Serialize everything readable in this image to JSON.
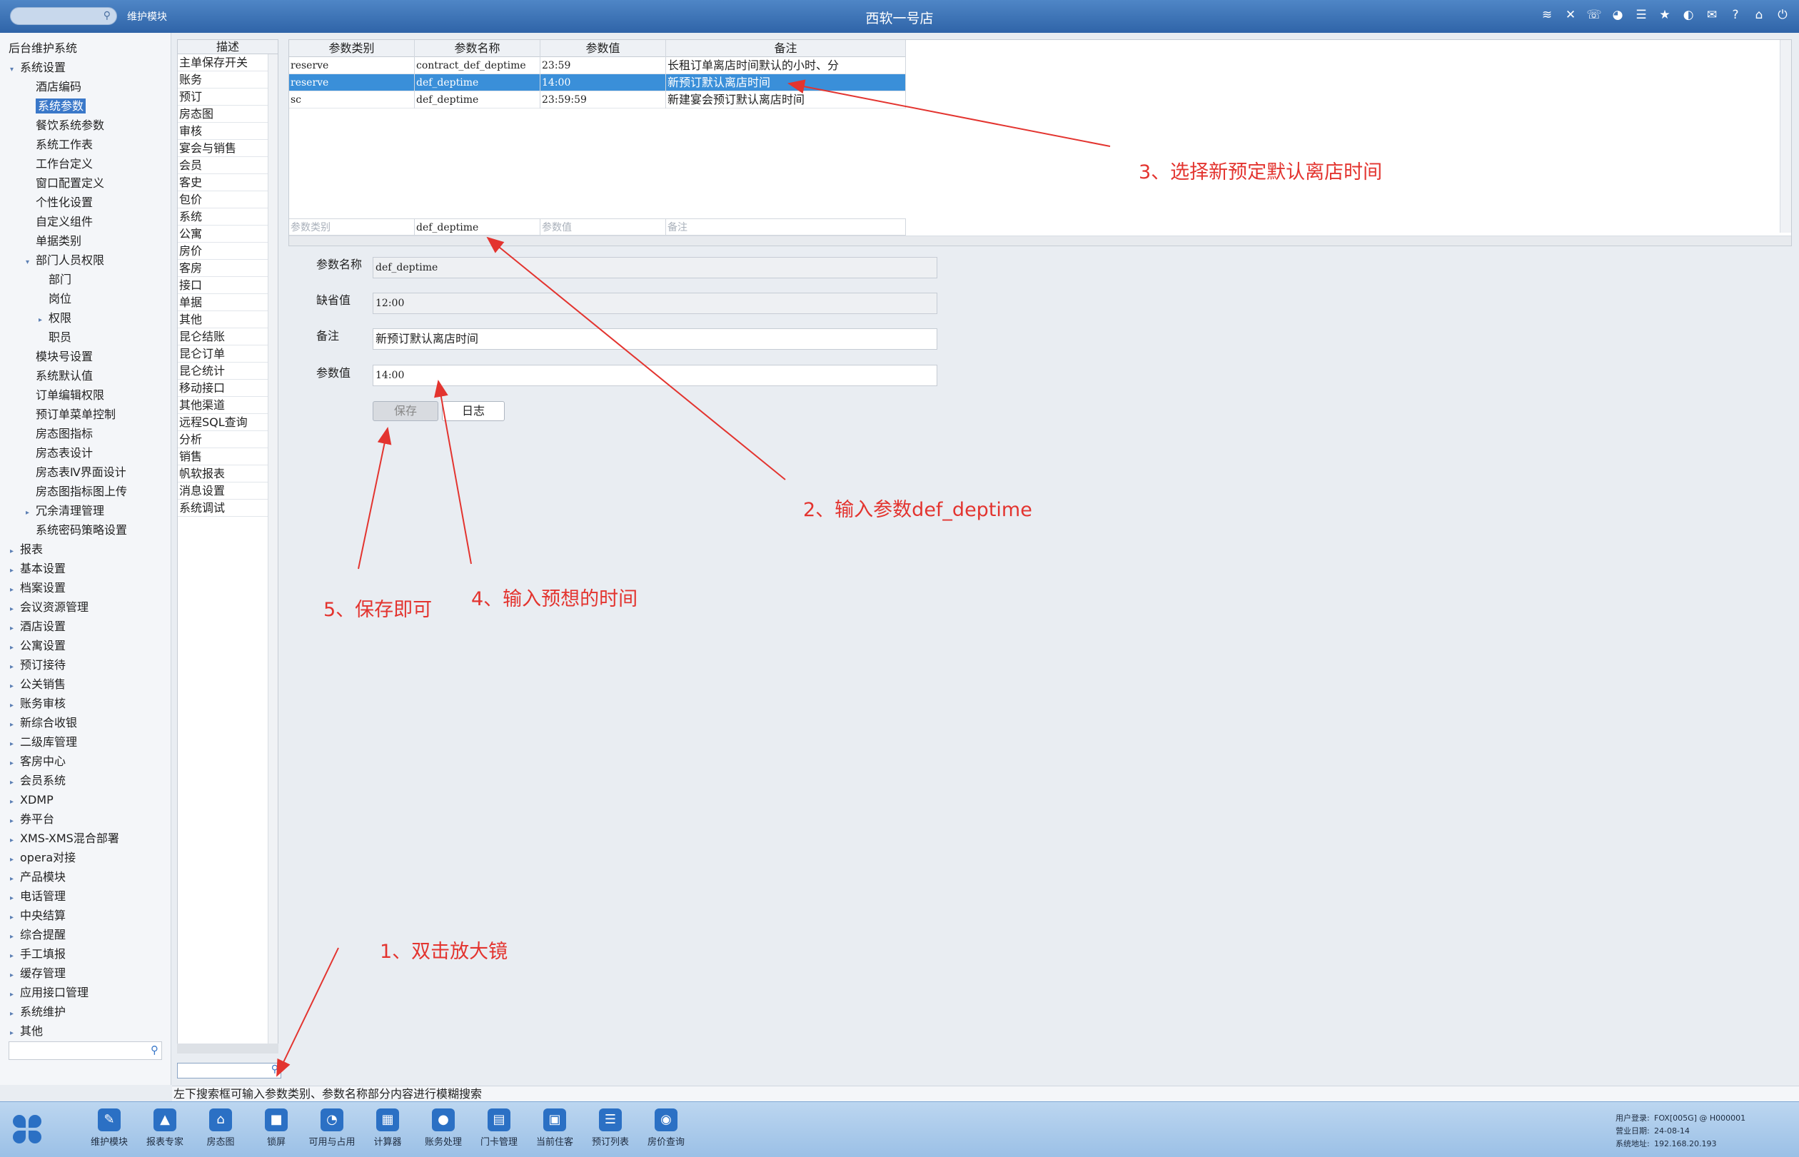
{
  "titlebar": {
    "module": "维护模块",
    "store": "西软一号店",
    "icons": [
      "wifi-icon",
      "tools-icon",
      "phone-icon",
      "palette-icon",
      "menu-icon",
      "star-icon",
      "contrast-icon",
      "mail-icon",
      "help-icon",
      "home-icon",
      "power-icon"
    ]
  },
  "nav": {
    "root": "后台维护系统",
    "items": [
      {
        "label": "系统设置",
        "level": 1,
        "arrow": "▾"
      },
      {
        "label": "酒店编码",
        "level": 2,
        "arrow": ""
      },
      {
        "label": "系统参数",
        "level": 2,
        "arrow": "",
        "selected": true
      },
      {
        "label": "餐饮系统参数",
        "level": 2,
        "arrow": ""
      },
      {
        "label": "系统工作表",
        "level": 2,
        "arrow": ""
      },
      {
        "label": "工作台定义",
        "level": 2,
        "arrow": ""
      },
      {
        "label": "窗口配置定义",
        "level": 2,
        "arrow": ""
      },
      {
        "label": "个性化设置",
        "level": 2,
        "arrow": ""
      },
      {
        "label": "自定义组件",
        "level": 2,
        "arrow": ""
      },
      {
        "label": "单据类别",
        "level": 2,
        "arrow": ""
      },
      {
        "label": "部门人员权限",
        "level": 2,
        "arrow": "▾"
      },
      {
        "label": "部门",
        "level": 3,
        "arrow": ""
      },
      {
        "label": "岗位",
        "level": 3,
        "arrow": ""
      },
      {
        "label": "权限",
        "level": 3,
        "arrow": "▸"
      },
      {
        "label": "职员",
        "level": 3,
        "arrow": ""
      },
      {
        "label": "模块号设置",
        "level": 2,
        "arrow": ""
      },
      {
        "label": "系统默认值",
        "level": 2,
        "arrow": ""
      },
      {
        "label": "订单编辑权限",
        "level": 2,
        "arrow": ""
      },
      {
        "label": "预订单菜单控制",
        "level": 2,
        "arrow": ""
      },
      {
        "label": "房态图指标",
        "level": 2,
        "arrow": ""
      },
      {
        "label": "房态表设计",
        "level": 2,
        "arrow": ""
      },
      {
        "label": "房态表Ⅳ界面设计",
        "level": 2,
        "arrow": ""
      },
      {
        "label": "房态图指标图上传",
        "level": 2,
        "arrow": ""
      },
      {
        "label": "冗余清理管理",
        "level": 2,
        "arrow": "▸"
      },
      {
        "label": "系统密码策略设置",
        "level": 2,
        "arrow": ""
      },
      {
        "label": "报表",
        "level": 1,
        "arrow": "▸"
      },
      {
        "label": "基本设置",
        "level": 1,
        "arrow": "▸"
      },
      {
        "label": "档案设置",
        "level": 1,
        "arrow": "▸"
      },
      {
        "label": "会议资源管理",
        "level": 1,
        "arrow": "▸"
      },
      {
        "label": "酒店设置",
        "level": 1,
        "arrow": "▸"
      },
      {
        "label": "公寓设置",
        "level": 1,
        "arrow": "▸"
      },
      {
        "label": "预订接待",
        "level": 1,
        "arrow": "▸"
      },
      {
        "label": "公关销售",
        "level": 1,
        "arrow": "▸"
      },
      {
        "label": "账务审核",
        "level": 1,
        "arrow": "▸"
      },
      {
        "label": "新综合收银",
        "level": 1,
        "arrow": "▸"
      },
      {
        "label": "二级库管理",
        "level": 1,
        "arrow": "▸"
      },
      {
        "label": "客房中心",
        "level": 1,
        "arrow": "▸"
      },
      {
        "label": "会员系统",
        "level": 1,
        "arrow": "▸"
      },
      {
        "label": "XDMP",
        "level": 1,
        "arrow": "▸"
      },
      {
        "label": "券平台",
        "level": 1,
        "arrow": "▸"
      },
      {
        "label": "XMS-XMS混合部署",
        "level": 1,
        "arrow": "▸"
      },
      {
        "label": "opera对接",
        "level": 1,
        "arrow": "▸"
      },
      {
        "label": "产品模块",
        "level": 1,
        "arrow": "▸"
      },
      {
        "label": "电话管理",
        "level": 1,
        "arrow": "▸"
      },
      {
        "label": "中央结算",
        "level": 1,
        "arrow": "▸"
      },
      {
        "label": "综合提醒",
        "level": 1,
        "arrow": "▸"
      },
      {
        "label": "手工填报",
        "level": 1,
        "arrow": "▸"
      },
      {
        "label": "缓存管理",
        "level": 1,
        "arrow": "▸"
      },
      {
        "label": "应用接口管理",
        "level": 1,
        "arrow": "▸"
      },
      {
        "label": "系统维护",
        "level": 1,
        "arrow": "▸"
      },
      {
        "label": "其他",
        "level": 1,
        "arrow": "▸"
      }
    ]
  },
  "desc": {
    "header": "描述",
    "rows": [
      "主单保存开关",
      "账务",
      "预订",
      "房态图",
      "审核",
      "宴会与销售",
      "会员",
      "客史",
      "包价",
      "系统",
      "公寓",
      "房价",
      "客房",
      "接口",
      "单据",
      "其他",
      "昆仑结账",
      "昆仑订单",
      "昆仑统计",
      "移动接口",
      "其他渠道",
      "远程SQL查询",
      "分析",
      "销售",
      "帆软报表",
      "消息设置",
      "系统调试"
    ]
  },
  "table": {
    "columns": [
      "参数类别",
      "参数名称",
      "参数值",
      "备注"
    ],
    "rows": [
      [
        "reserve",
        "contract_def_deptime",
        "23:59",
        "长租订单离店时间默认的小时、分"
      ],
      [
        "reserve",
        "def_deptime",
        "14:00",
        "新预订默认离店时间"
      ],
      [
        "sc",
        "def_deptime",
        "23:59:59",
        "新建宴会预订默认离店时间"
      ]
    ],
    "selected_row": 1,
    "filter": [
      "参数类别",
      "def_deptime",
      "参数值",
      "备注"
    ]
  },
  "form": {
    "name_label": "参数名称",
    "name_value": "def_deptime",
    "default_label": "缺省值",
    "default_value": "12:00",
    "remark_label": "备注",
    "remark_value": "新预订默认离店时间",
    "value_label": "参数值",
    "value_value": "14:00",
    "save": "保存",
    "log": "日志"
  },
  "annotations": {
    "a1": "1、双击放大镜",
    "a2": "2、输入参数def_deptime",
    "a3": "3、选择新预定默认离店时间",
    "a4": "4、输入预想的时间",
    "a5": "5、保存即可",
    "color": "#e3342f"
  },
  "status": "左下搜索框可输入参数类别、参数名称部分内容进行模糊搜索",
  "taskbar": {
    "items": [
      {
        "label": "维护模块",
        "icon": "wrench-icon",
        "glyph": "✎"
      },
      {
        "label": "报表专家",
        "icon": "graduation-icon",
        "glyph": "▲"
      },
      {
        "label": "房态图",
        "icon": "building-icon",
        "glyph": "⌂"
      },
      {
        "label": "锁屏",
        "icon": "lock-icon",
        "glyph": "■"
      },
      {
        "label": "可用与占用",
        "icon": "pie-chart-icon",
        "glyph": "◔"
      },
      {
        "label": "计算器",
        "icon": "calculator-icon",
        "glyph": "▦"
      },
      {
        "label": "账务处理",
        "icon": "accounting-icon",
        "glyph": "●"
      },
      {
        "label": "门卡管理",
        "icon": "door-card-icon",
        "glyph": "▤"
      },
      {
        "label": "当前住客",
        "icon": "guest-card-icon",
        "glyph": "▣"
      },
      {
        "label": "预订列表",
        "icon": "booking-list-icon",
        "glyph": "☰"
      },
      {
        "label": "房价查询",
        "icon": "rate-query-icon",
        "glyph": "◉"
      }
    ],
    "user_label": "用户登录:",
    "user": "FOX[005G] @ H000001",
    "date_label": "营业日期:",
    "date": "24-08-14",
    "addr_label": "系统地址:",
    "addr": "192.168.20.193"
  },
  "colors": {
    "accent": "#3a78c9",
    "titlebar": "#3a6fb3",
    "selection": "#3a8fd9"
  }
}
